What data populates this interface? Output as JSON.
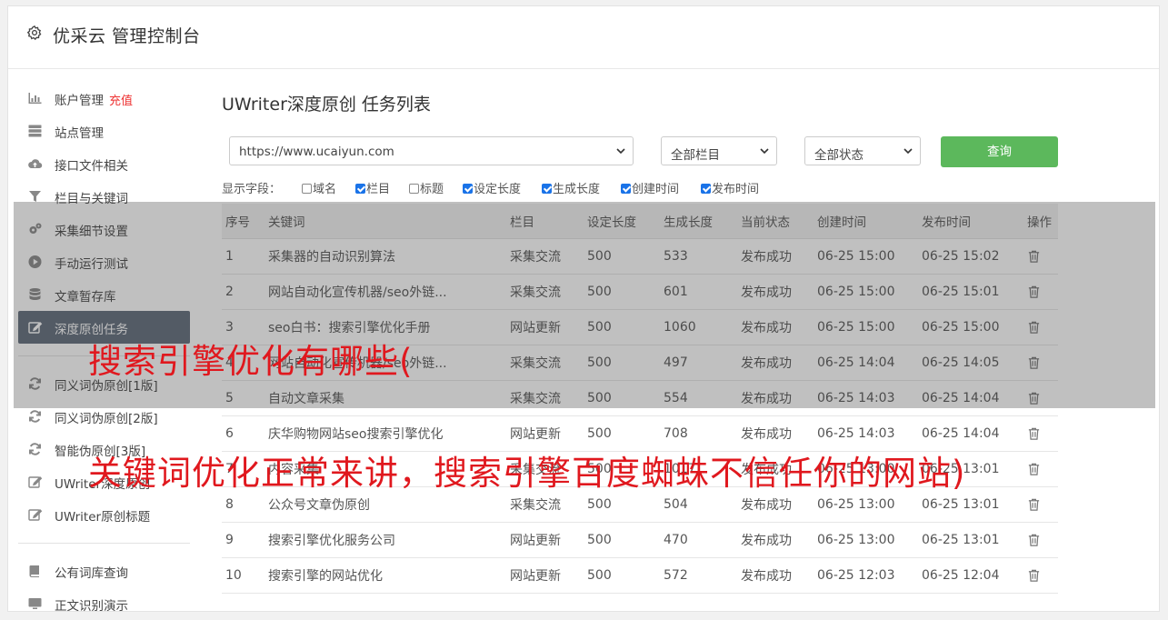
{
  "header": {
    "title": "优采云 管理控制台",
    "icon": "gear-icon"
  },
  "sidebar": {
    "group1": [
      {
        "label": "账户管理",
        "extra": "充值",
        "icon": "bar-chart-icon"
      },
      {
        "label": "站点管理",
        "icon": "server-icon"
      },
      {
        "label": "接口文件相关",
        "icon": "cloud-upload-icon"
      },
      {
        "label": "栏目与关键词",
        "icon": "filter-icon"
      },
      {
        "label": "采集细节设置",
        "icon": "gears-icon"
      },
      {
        "label": "手动运行测试",
        "icon": "play-circle-icon"
      },
      {
        "label": "文章暂存库",
        "icon": "database-icon"
      },
      {
        "label": "深度原创任务",
        "icon": "edit-icon",
        "active": true
      }
    ],
    "group2": [
      {
        "label": "同义词伪原创[1版]",
        "icon": "refresh-icon"
      },
      {
        "label": "同义词伪原创[2版]",
        "icon": "refresh-icon"
      },
      {
        "label": "智能伪原创[3版]",
        "icon": "refresh-icon"
      },
      {
        "label": "UWriter深度原创",
        "icon": "edit-icon"
      },
      {
        "label": "UWriter原创标题",
        "icon": "edit-icon"
      }
    ],
    "group3": [
      {
        "label": "公有词库查询",
        "icon": "book-icon"
      },
      {
        "label": "正文识别演示",
        "icon": "monitor-icon"
      }
    ]
  },
  "main": {
    "title": "UWriter深度原创 任务列表",
    "site_select": "https://www.ucaiyun.com",
    "column_select": "全部栏目",
    "status_select": "全部状态",
    "query_label": "查询",
    "fields_label": "显示字段：",
    "fields": [
      {
        "label": "域名",
        "checked": false
      },
      {
        "label": "栏目",
        "checked": true
      },
      {
        "label": "标题",
        "checked": false
      },
      {
        "label": "设定长度",
        "checked": true
      },
      {
        "label": "生成长度",
        "checked": true
      },
      {
        "label": "创建时间",
        "checked": true
      },
      {
        "label": "发布时间",
        "checked": true
      }
    ],
    "columns": [
      "序号",
      "关键词",
      "栏目",
      "设定长度",
      "生成长度",
      "当前状态",
      "创建时间",
      "发布时间",
      "操作"
    ],
    "rows": [
      [
        "1",
        "采集器的自动识别算法",
        "采集交流",
        "500",
        "533",
        "发布成功",
        "06-25 15:00",
        "06-25 15:02"
      ],
      [
        "2",
        "网站自动化宣传机器/seo外链...",
        "采集交流",
        "500",
        "601",
        "发布成功",
        "06-25 15:00",
        "06-25 15:01"
      ],
      [
        "3",
        "seo白书：搜索引擎优化手册",
        "网站更新",
        "500",
        "1060",
        "发布成功",
        "06-25 15:00",
        "06-25 15:00"
      ],
      [
        "4",
        "网站自动化宣传机器/seo外链...",
        "采集交流",
        "500",
        "497",
        "发布成功",
        "06-25 14:04",
        "06-25 14:05"
      ],
      [
        "5",
        "自动文章采集",
        "采集交流",
        "500",
        "554",
        "发布成功",
        "06-25 14:03",
        "06-25 14:04"
      ],
      [
        "6",
        "庆华购物网站seo搜索引擎优化",
        "网站更新",
        "500",
        "708",
        "发布成功",
        "06-25 14:03",
        "06-25 14:04"
      ],
      [
        "7",
        "内容采集",
        "采集交流",
        "500",
        "1017",
        "发布成功",
        "06-25 13:00",
        "06-25 13:01"
      ],
      [
        "8",
        "公众号文章伪原创",
        "采集交流",
        "500",
        "504",
        "发布成功",
        "06-25 13:00",
        "06-25 13:01"
      ],
      [
        "9",
        "搜索引擎优化服务公司",
        "网站更新",
        "500",
        "470",
        "发布成功",
        "06-25 13:00",
        "06-25 13:01"
      ],
      [
        "10",
        "搜索引擎的网站优化",
        "网站更新",
        "500",
        "572",
        "发布成功",
        "06-25 12:03",
        "06-25 12:04"
      ]
    ]
  },
  "overlay": {
    "line1": "搜索引擎优化有哪些(",
    "line2": "关键词优化正常来讲，搜索引擎百度蜘蛛不信任你的网站)"
  },
  "colors": {
    "accent": "#5cb85c",
    "status_ok": "#3c8d2f",
    "active_item": "#5f6a7a",
    "overlay_text": "#e0181e"
  }
}
